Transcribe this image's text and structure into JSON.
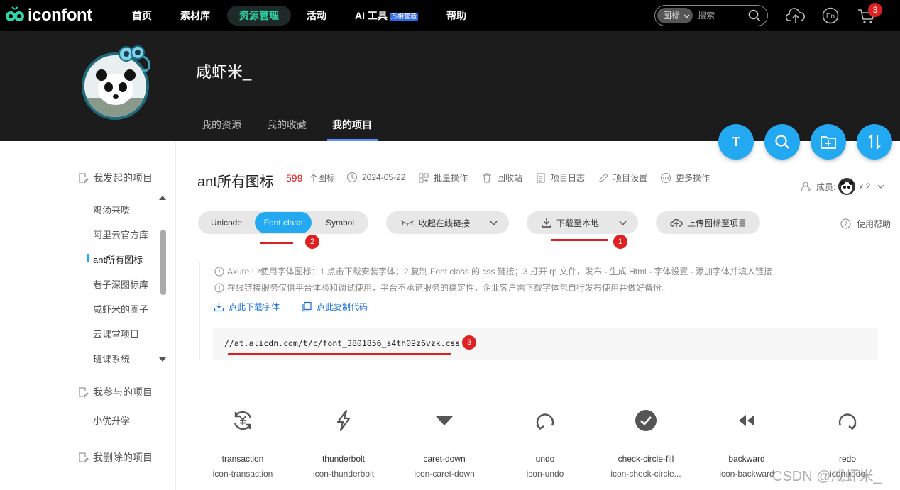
{
  "nav": {
    "logo_text": "iconfont",
    "items": [
      "首页",
      "素材库",
      "资源管理",
      "活动",
      "AI 工具",
      "帮助"
    ],
    "ai_badge": "万相营造",
    "search_type": "图标",
    "search_placeholder": "搜索",
    "cart_count": "3",
    "lang_label": "En",
    "colors": {
      "accent": "#2fd5a6",
      "badge": "#e02020"
    }
  },
  "header": {
    "username": "咸虾米_",
    "tabs": [
      "我的资源",
      "我的收藏",
      "我的项目"
    ],
    "fabs": [
      "T",
      "search",
      "add-folder",
      "sort"
    ]
  },
  "sidebar": {
    "started_title": "我发起的项目",
    "started_items": [
      "鸡汤来喽",
      "阿里云官方库",
      "ant所有图标",
      "巷子深图标库",
      "咸虾米的圈子",
      "云课堂项目",
      "班课系统"
    ],
    "joined_title": "我参与的项目",
    "joined_items": [
      "小优升学"
    ],
    "deleted_title": "我删除的项目"
  },
  "project": {
    "title": "ant所有图标",
    "count": "599",
    "count_label": "个图标",
    "date": "2024-05-22",
    "actions": [
      "批量操作",
      "回收站",
      "项目日志",
      "项目设置",
      "更多操作"
    ],
    "members_label": "成员:",
    "members_count": "x 2"
  },
  "toolbar": {
    "segments": [
      "Unicode",
      "Font class",
      "Symbol"
    ],
    "collapse_label": "收起在线链接",
    "download_label": "下载至本地",
    "upload_label": "上传图标至项目",
    "help_label": "使用帮助"
  },
  "annotations": [
    "1",
    "2",
    "3"
  ],
  "notice": {
    "line1": "Axure 中使用字体图标：1.点击下载安装字体；2.复制 Font class 的 css 链接；3.打开 rp 文件，发布 - 生成 Html - 字体设置 - 添加字体并填入链接",
    "line2": "在线链接服务仅供平台体验和调试使用，平台不承诺服务的稳定性，企业客户需下载字体包自行发布使用并做好备份。",
    "download_font": "点此下载字体",
    "copy_code": "点此复制代码",
    "css_link": "//at.alicdn.com/t/c/font_3801856_s4th09z6vzk.css"
  },
  "icons": [
    {
      "name": "transaction",
      "code": "icon-transaction"
    },
    {
      "name": "thunderbolt",
      "code": "icon-thunderbolt"
    },
    {
      "name": "caret-down",
      "code": "icon-caret-down"
    },
    {
      "name": "undo",
      "code": "icon-undo"
    },
    {
      "name": "check-circle-fill",
      "code": "icon-check-circle..."
    },
    {
      "name": "backward",
      "code": "icon-backward"
    },
    {
      "name": "redo",
      "code": "icon-redo"
    }
  ],
  "watermark": "CSDN @咸虾米_"
}
